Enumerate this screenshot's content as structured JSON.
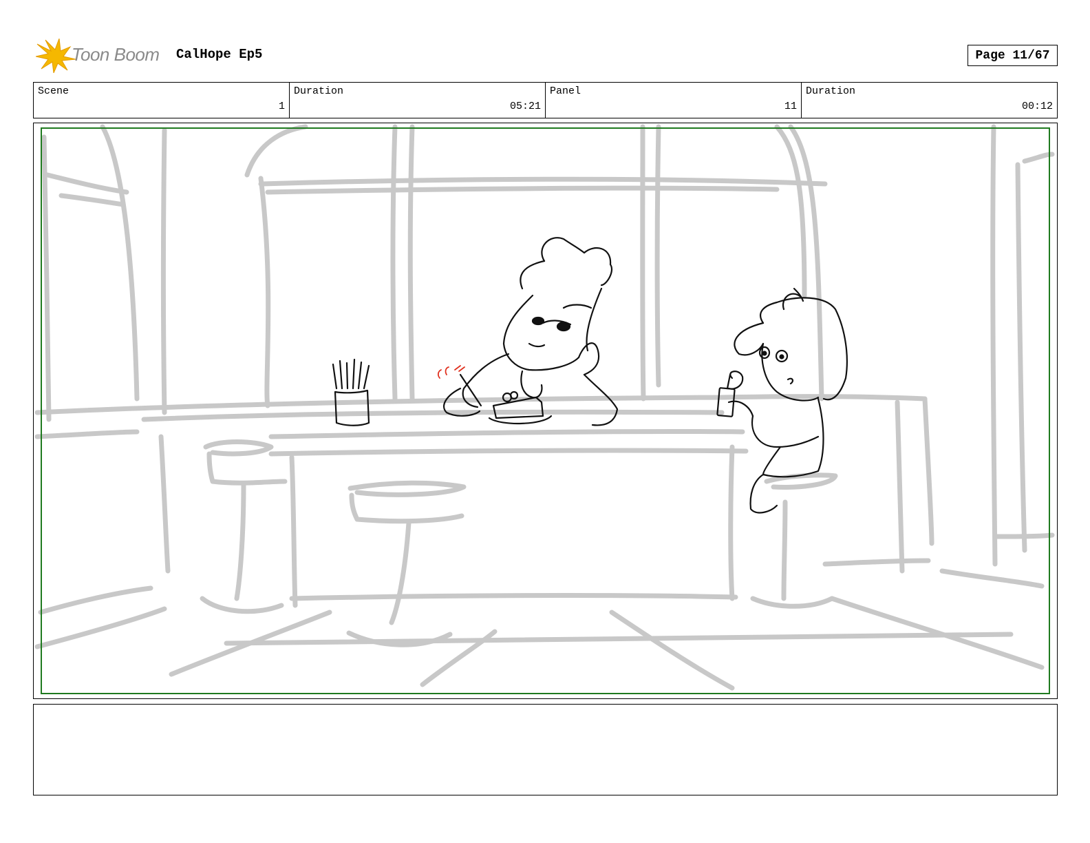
{
  "header": {
    "logo_text": "Toon Boom",
    "project_title": "CalHope Ep5",
    "page_label": "Page 11/67"
  },
  "info": {
    "scene_label": "Scene",
    "scene_value": "1",
    "scene_duration_label": "Duration",
    "scene_duration_value": "05:21",
    "panel_label": "Panel",
    "panel_value": "11",
    "panel_duration_label": "Duration",
    "panel_duration_value": "00:12"
  },
  "colors": {
    "safe_frame": "#1f7a1f",
    "sketch_background": "#c8c8c8",
    "sketch_ink": "#111111",
    "logo_star": "#f5b800",
    "accent_marks": "#e0301e"
  },
  "icons": {
    "logo": "toon-boom-star-logo"
  },
  "notes": {
    "text": ""
  }
}
